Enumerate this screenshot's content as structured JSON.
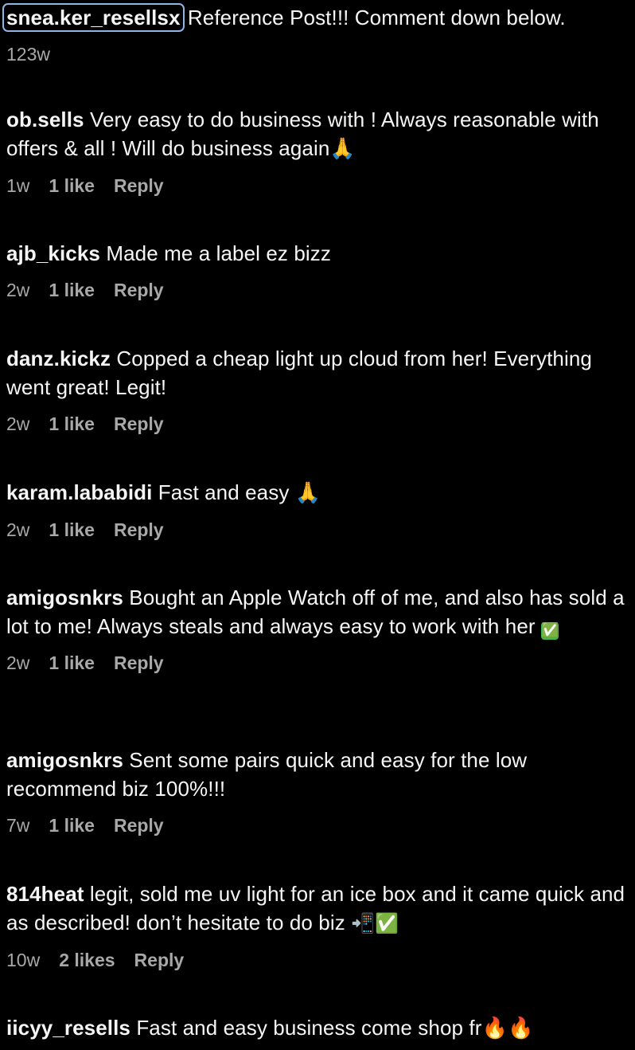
{
  "comments": [
    {
      "username": "snea.ker_resellsx",
      "text": " Reference Post!!! Comment down below.",
      "time": "123w",
      "likes": "",
      "reply": ""
    },
    {
      "username": "ob.sells",
      "text": " Very easy to do business with ! Always reasonable with offers & all ! Will do business again",
      "emoji": "🙏",
      "time": "1w",
      "likes": "1 like",
      "reply": "Reply"
    },
    {
      "username": "ajb_kicks",
      "text": " Made me a label ez bizz",
      "time": "2w",
      "likes": "1 like",
      "reply": "Reply"
    },
    {
      "username": "danz.kickz",
      "text": " Copped a cheap light up cloud from her! Everything went great! Legit!",
      "time": "2w",
      "likes": "1 like",
      "reply": "Reply"
    },
    {
      "username": "karam.lababidi",
      "text": " Fast and easy ",
      "emoji": "🙏",
      "time": "2w",
      "likes": "1 like",
      "reply": "Reply"
    },
    {
      "username": "amigosnkrs",
      "text": " Bought an Apple Watch off of me, and also has sold a lot to me! Always steals and always easy to work with her ",
      "emoji": "✅",
      "time": "2w",
      "likes": "1 like",
      "reply": "Reply"
    },
    {
      "username": "amigosnkrs",
      "text": " Sent some pairs quick and easy for the low recommend biz 100%!!!",
      "time": "7w",
      "likes": "1 like",
      "reply": "Reply"
    },
    {
      "username": "814heat",
      "text": " legit, sold me uv light for an ice box and it came quick and as described! don’t hesitate to do biz ",
      "emoji": "📲✅",
      "time": "10w",
      "likes": "2 likes",
      "reply": "Reply"
    },
    {
      "username": "iicyy_resells",
      "text": " Fast and easy business come shop fr",
      "emoji": "🔥🔥",
      "time": "",
      "likes": "",
      "reply": ""
    }
  ]
}
